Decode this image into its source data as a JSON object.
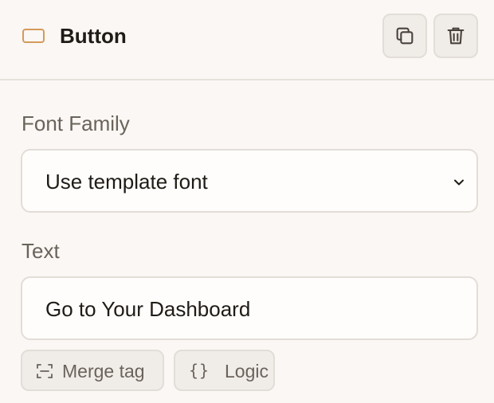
{
  "header": {
    "title": "Button",
    "block_icon": "button-block-icon",
    "actions": [
      {
        "icon": "copy-icon"
      },
      {
        "icon": "trash-icon"
      }
    ]
  },
  "font_family": {
    "label": "Font Family",
    "selected": "Use template font"
  },
  "text_field": {
    "label": "Text",
    "value": "Go to Your Dashboard"
  },
  "insert_buttons": {
    "merge_tag": "Merge tag",
    "logic": "Logic"
  },
  "colors": {
    "accent": "#d59a5b",
    "background": "#faf7f4",
    "border": "#e2ddd7",
    "muted_text": "#6b635b"
  }
}
